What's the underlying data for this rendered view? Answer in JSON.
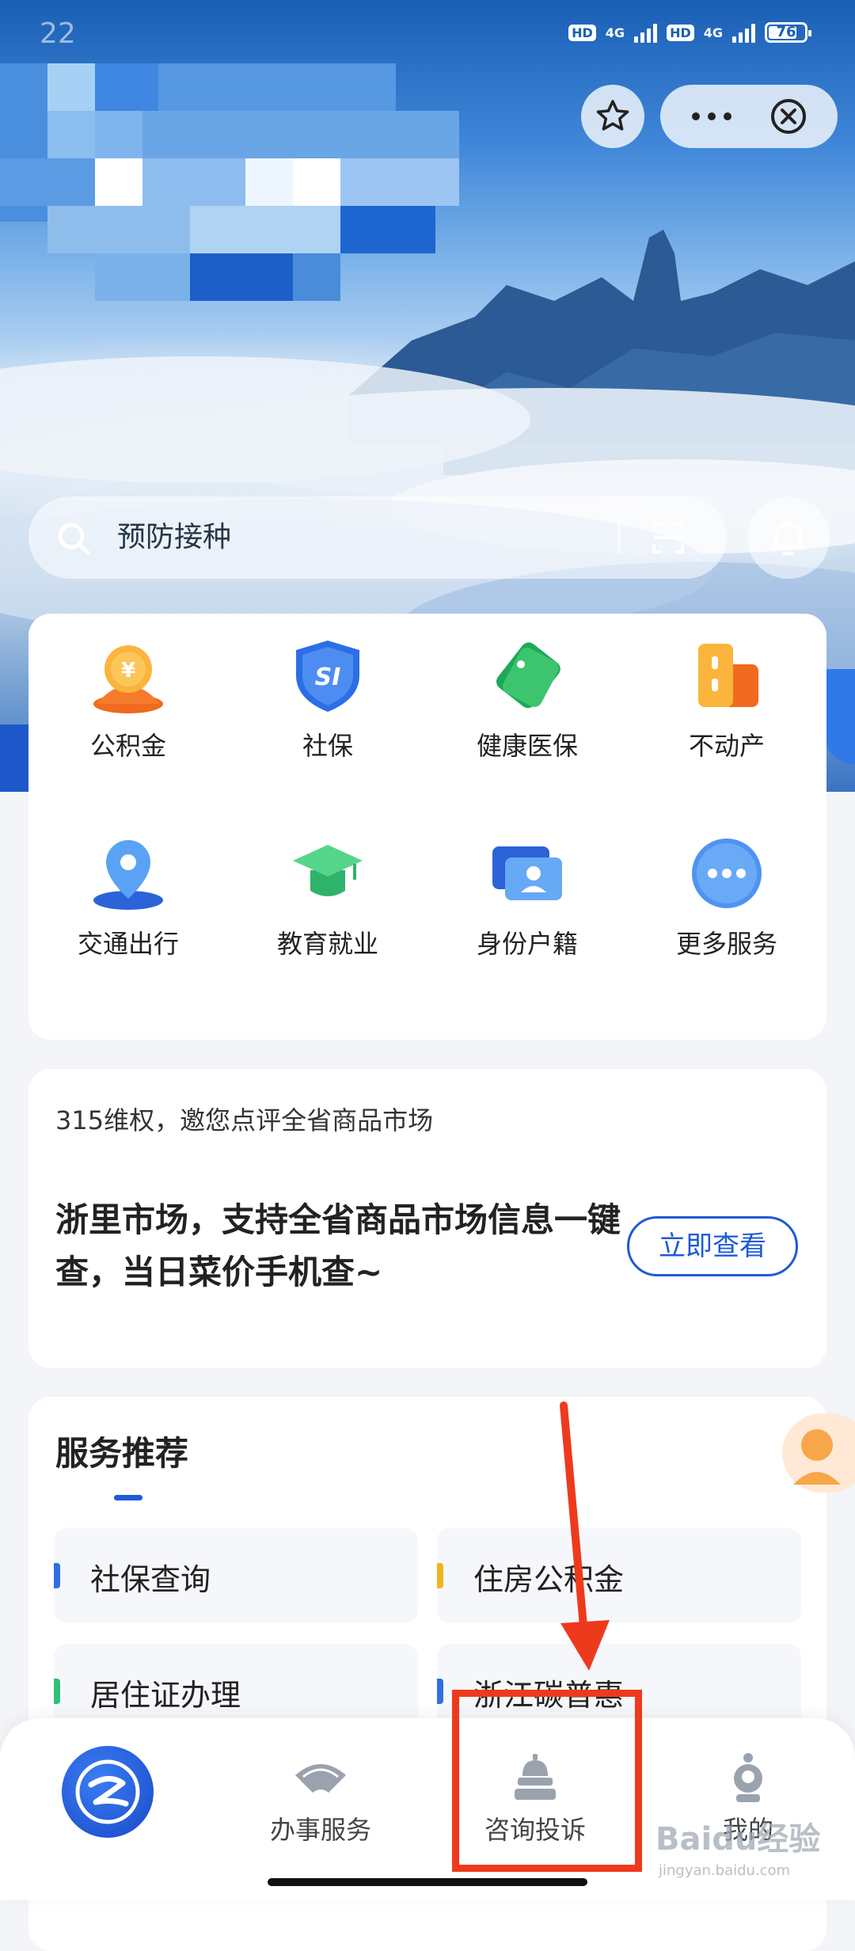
{
  "status_bar": {
    "time": "22",
    "network1": "4G",
    "network2": "4G",
    "hd_label": "HD",
    "battery": "76"
  },
  "search": {
    "placeholder": "预防接种"
  },
  "services": [
    {
      "label": "公积金",
      "icon": "housing-fund-icon"
    },
    {
      "label": "社保",
      "icon": "social-security-icon"
    },
    {
      "label": "健康医保",
      "icon": "health-insurance-icon"
    },
    {
      "label": "不动产",
      "icon": "real-estate-icon"
    },
    {
      "label": "交通出行",
      "icon": "traffic-icon"
    },
    {
      "label": "教育就业",
      "icon": "education-icon"
    },
    {
      "label": "身份户籍",
      "icon": "id-card-icon"
    },
    {
      "label": "更多服务",
      "icon": "more-services-icon"
    }
  ],
  "promo": {
    "subtitle": "315维权，邀您点评全省商品市场",
    "headline": "浙里市场，支持全省商品市场信息一键查，当日菜价手机查~",
    "button": "立即查看"
  },
  "recommend": {
    "title": "服务推荐",
    "items": [
      {
        "label": "社保查询",
        "color": "#2f6fe0"
      },
      {
        "label": "住房公积金",
        "color": "#f0b41c"
      },
      {
        "label": "居住证办理",
        "color": "#2fbf7a"
      },
      {
        "label": "浙江碳普惠",
        "color": "#2f6fe0"
      }
    ]
  },
  "tabbar": {
    "tabs": [
      {
        "label": "办事服务"
      },
      {
        "label": "咨询投诉"
      },
      {
        "label": "我的"
      }
    ]
  },
  "watermark": {
    "text": "Baidu经验",
    "sub": "jingyan.baidu.com"
  },
  "colors": {
    "accent": "#1e5bd6",
    "highlight": "#ee3a1c"
  }
}
